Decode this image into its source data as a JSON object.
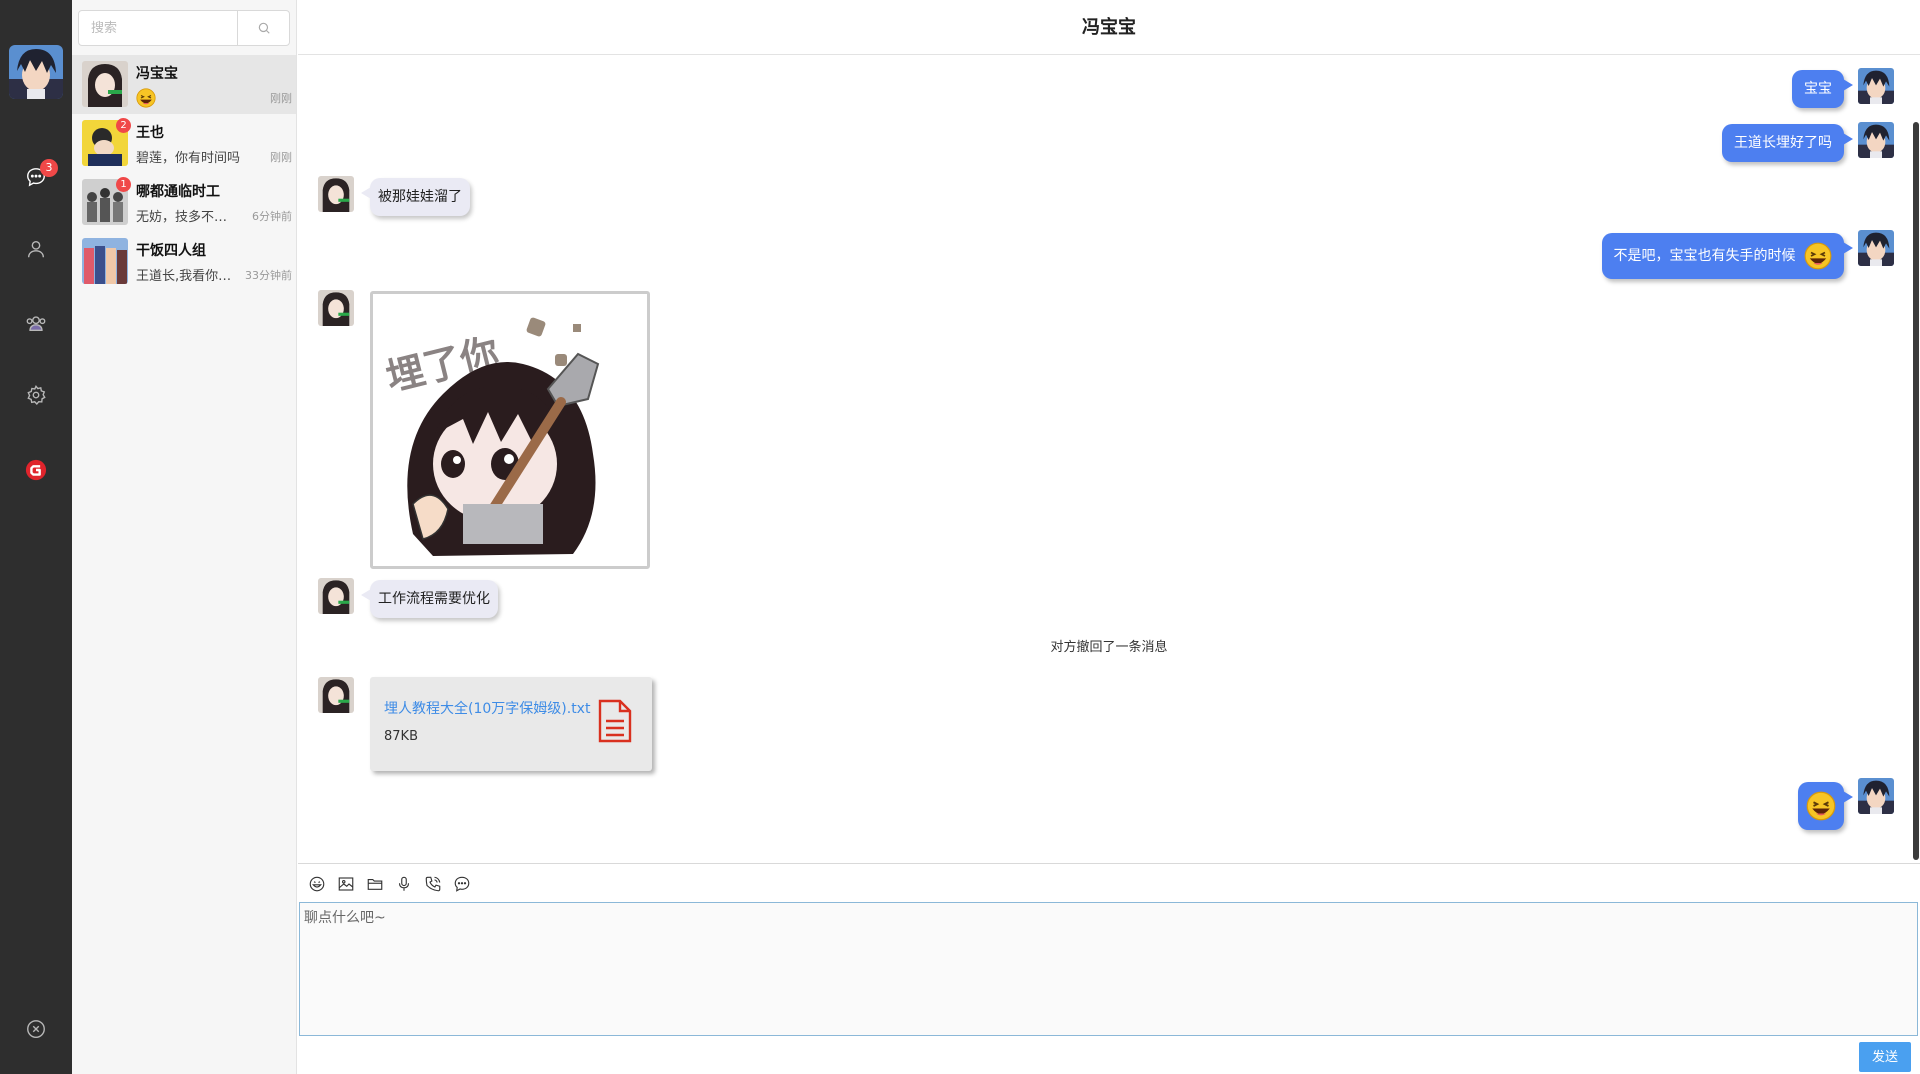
{
  "rail": {
    "chat_badge": "3",
    "icons": [
      "chat-icon",
      "contacts-icon",
      "group-icon",
      "settings-icon",
      "brand-logo-icon",
      "close-icon"
    ]
  },
  "search": {
    "placeholder": "搜索"
  },
  "contacts": [
    {
      "name": "冯宝宝",
      "preview": "",
      "preview_emoji": "laughing-emoji",
      "time": "刚刚",
      "badge": ""
    },
    {
      "name": "王也",
      "preview": "碧莲，你有时间吗",
      "time": "刚刚",
      "badge": "2"
    },
    {
      "name": "哪都通临时工",
      "preview": "无妨，技多不压身嘛",
      "time": "6分钟前",
      "badge": "1"
    },
    {
      "name": "干饭四人组",
      "preview": "王道长,我看你才是懒",
      "time": "33分钟前",
      "badge": ""
    }
  ],
  "chat": {
    "title": "冯宝宝",
    "messages": {
      "m1": "宝宝",
      "m2": "王道长埋好了吗",
      "m3": "被那娃娃溜了",
      "m4": "不是吧，宝宝也有失手的时候",
      "sticker_text": "埋了你",
      "m6": "工作流程需要优化",
      "recall": "对方撤回了一条消息",
      "file_name": "埋人教程大全(10万字保姆级).txt",
      "file_size": "87KB"
    }
  },
  "composer": {
    "placeholder": "聊点什么吧~",
    "send_label": "发送",
    "tools": [
      "emoji-icon",
      "image-icon",
      "folder-icon",
      "microphone-icon",
      "phone-icon",
      "message-icon"
    ]
  },
  "colors": {
    "accent": "#4d7ff0",
    "rail": "#2e2e2e",
    "badge": "#f04848",
    "send": "#4aa0f0"
  }
}
